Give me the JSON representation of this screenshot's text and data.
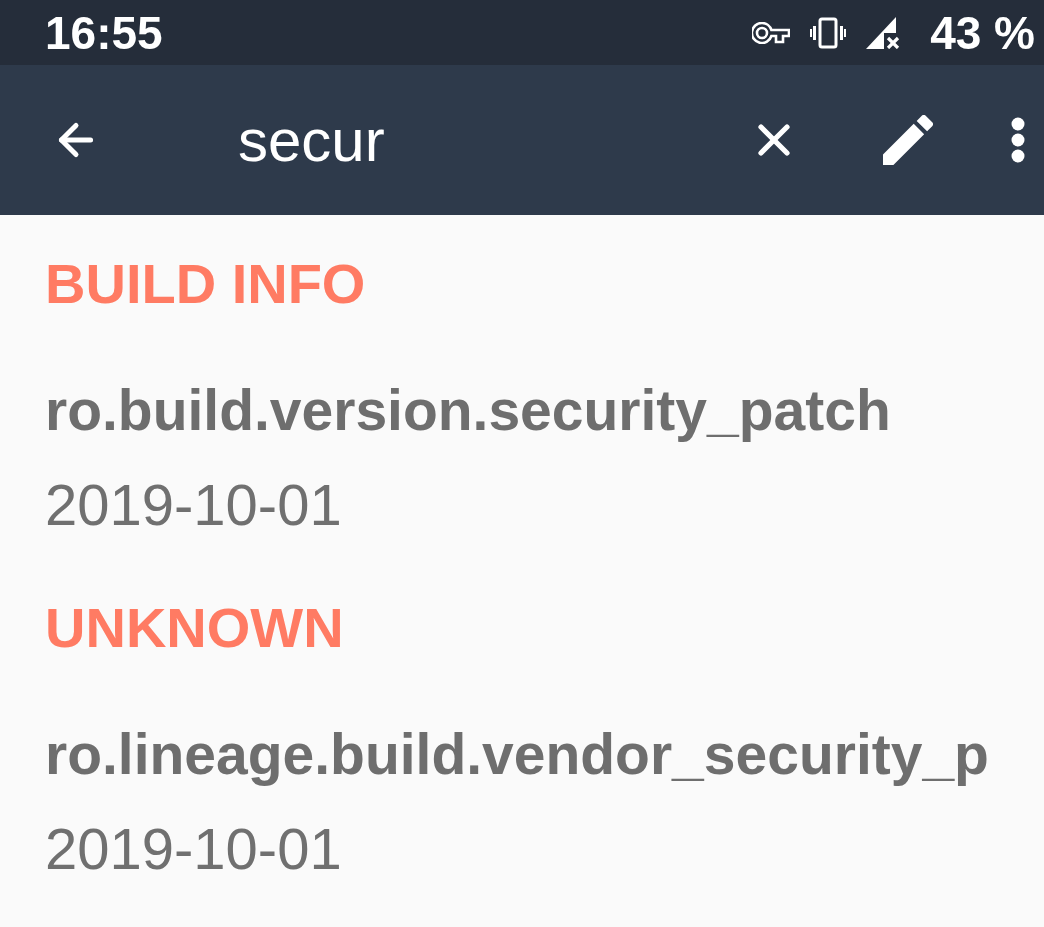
{
  "status_bar": {
    "time": "16:55",
    "battery": "43 %"
  },
  "toolbar": {
    "search": {
      "value": "secur"
    }
  },
  "sections": [
    {
      "title": "BUILD INFO",
      "items": [
        {
          "key": "ro.build.version.security_patch",
          "value": "2019-10-01"
        }
      ]
    },
    {
      "title": "UNKNOWN",
      "items": [
        {
          "key": "ro.lineage.build.vendor_security_p",
          "value": "2019-10-01"
        }
      ]
    }
  ]
}
